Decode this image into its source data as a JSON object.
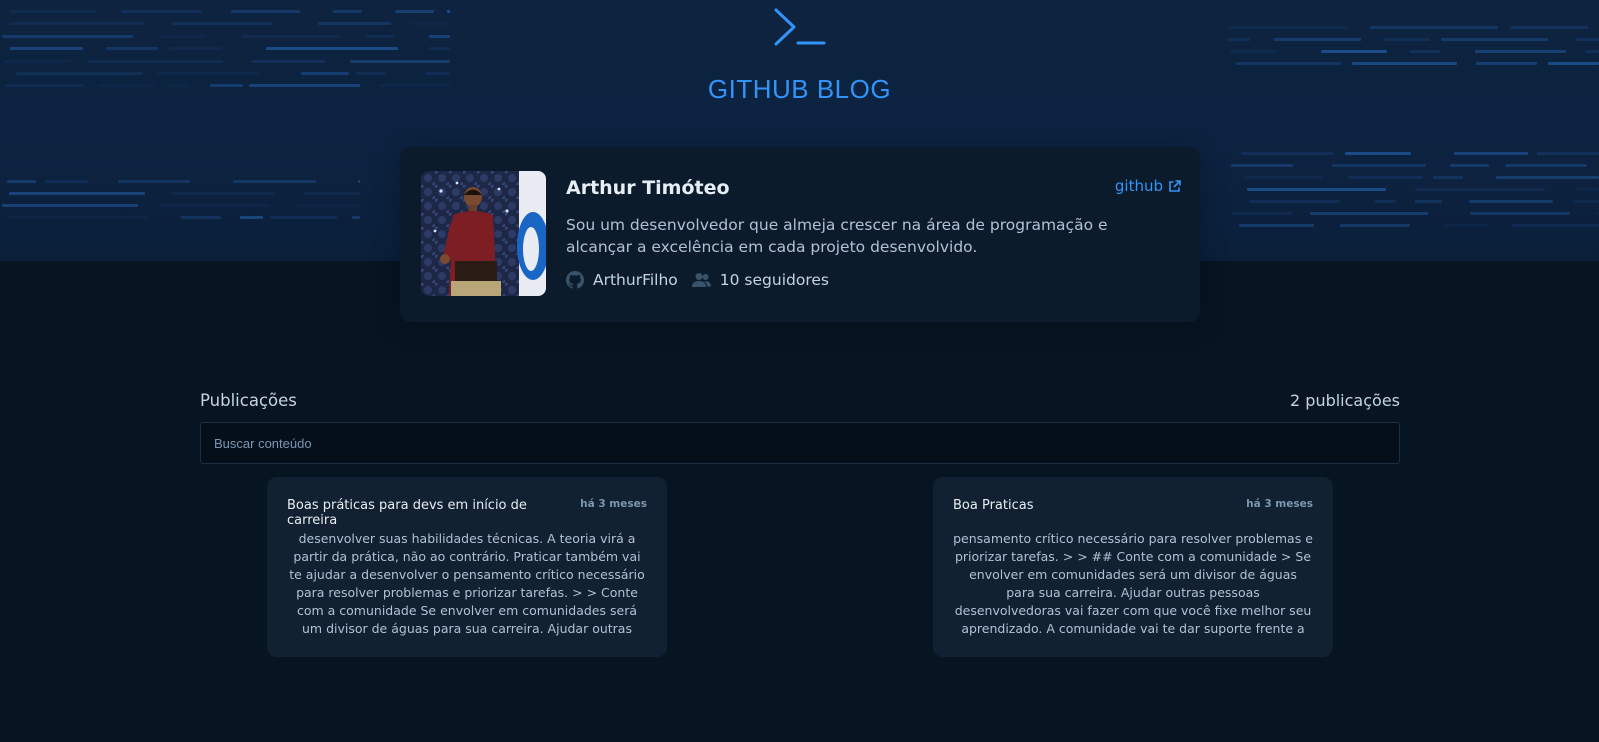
{
  "header": {
    "brand_title": "GITHUB BLOG",
    "logo_icon": "terminal-icon",
    "accent_color": "#3294f8"
  },
  "profile": {
    "name": "Arthur Timóteo",
    "github_link_label": "github",
    "bio": "Sou um desenvolvedor que almeja crescer na área de programação e alcançar a excelência em cada projeto desenvolvido.",
    "username": "ArthurFilho",
    "followers": "10 seguidores"
  },
  "publications": {
    "section_label": "Publicações",
    "count_label": "2 publicações",
    "search_placeholder": "Buscar conteúdo",
    "search_value": ""
  },
  "posts": [
    {
      "title": "Boas práticas para devs em início de carreira",
      "date": "há 3 meses",
      "excerpt": "desenvolver suas habilidades técnicas. A teoria virá a partir da prática, não ao contrário. Praticar também vai te ajudar a desenvolver o pensamento crítico necessário para resolver problemas e priorizar tarefas. > > Conte com a comunidade Se envolver em comunidades será um divisor de águas para sua carreira. Ajudar outras pessoas desenvolvedoras vai"
    },
    {
      "title": "Boa Praticas",
      "date": "há 3 meses",
      "excerpt": "pensamento crítico necessário para resolver problemas e priorizar tarefas. > > ## Conte com a comunidade > Se envolver em comunidades será um divisor de águas para sua carreira. Ajudar outras pessoas desenvolvedoras vai fazer com que você fixe melhor seu aprendizado. A comunidade vai te dar suporte frente a problemas"
    }
  ]
}
